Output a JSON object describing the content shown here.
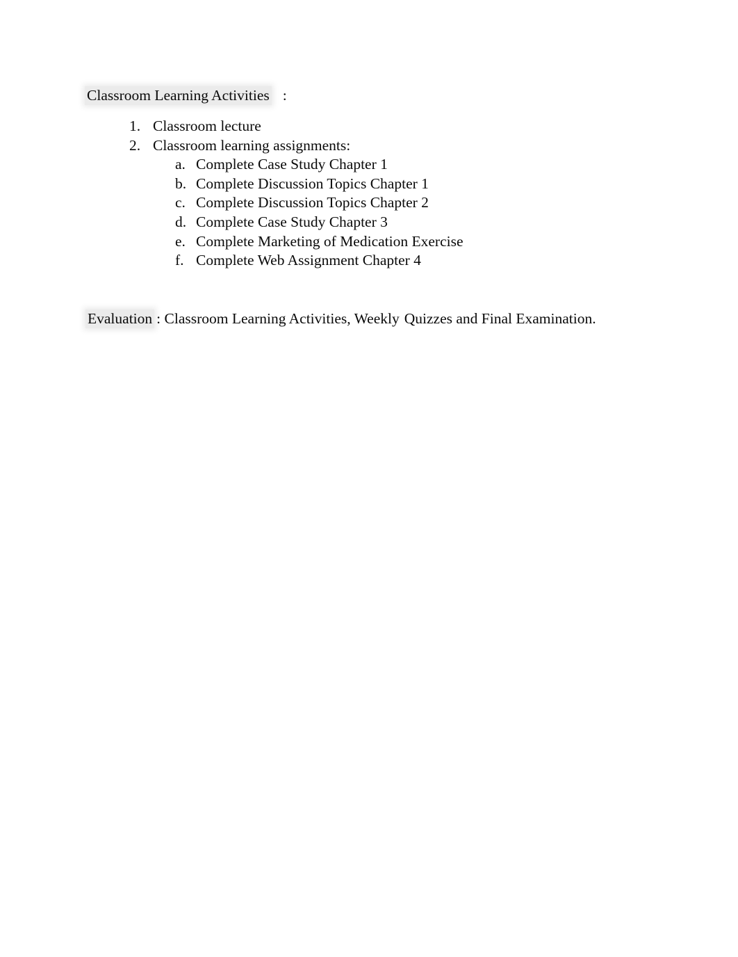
{
  "document": {
    "heading": {
      "label": "Classroom Learning Activities",
      "colon": ":"
    },
    "numbered_list": [
      {
        "marker": "1.",
        "label": "Classroom lecture"
      },
      {
        "marker": "2.",
        "label": "Classroom learning assignments:"
      }
    ],
    "lettered_list": [
      {
        "marker": "a.",
        "label": "Complete Case Study Chapter 1"
      },
      {
        "marker": "b.",
        "label": "Complete Discussion Topics Chapter 1"
      },
      {
        "marker": "c.",
        "label": "Complete Discussion Topics Chapter 2"
      },
      {
        "marker": "d.",
        "label": "Complete Case Study Chapter 3"
      },
      {
        "marker": "e.",
        "label": "Complete Marketing of Medication Exercise"
      },
      {
        "marker": "f.",
        "label": "Complete Web Assignment Chapter 4"
      }
    ],
    "evaluation": {
      "label": "Evaluation",
      "separator": ":",
      "part_one": "Classroom Learning Activities, Weekly",
      "part_two": "Quizzes and Final Examination."
    },
    "colors": {
      "page_background": "#ffffff",
      "text": "#0a0a0a",
      "highlight": "#ebebeb"
    }
  }
}
